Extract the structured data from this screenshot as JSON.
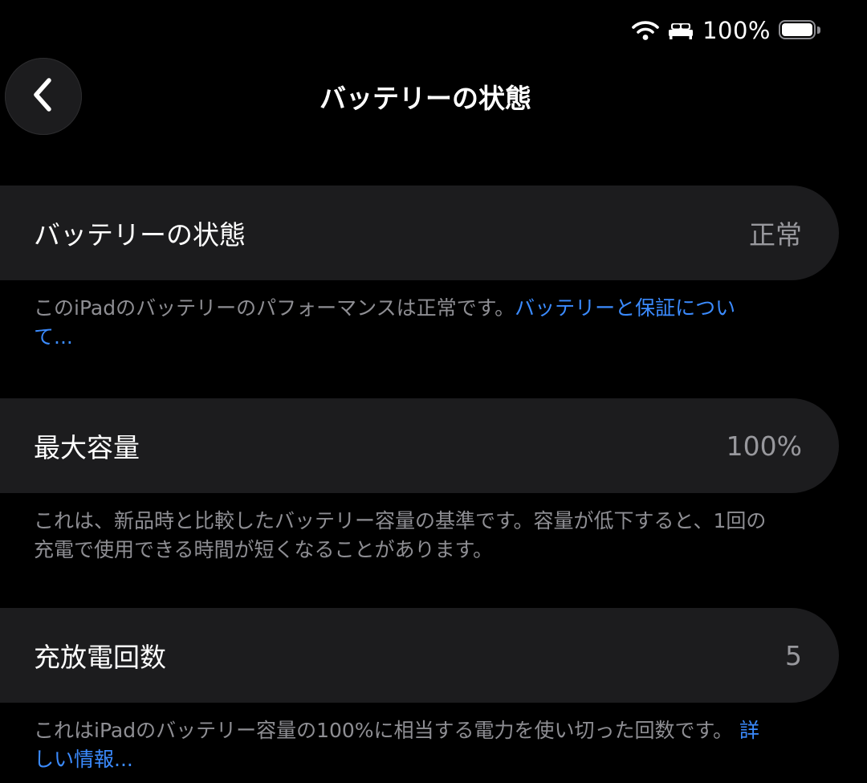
{
  "status_bar": {
    "wifi_icon": "wifi-icon",
    "sleep_icon": "bed-icon",
    "battery_percent": "100%",
    "battery_level": 1.0
  },
  "nav": {
    "back_icon": "chevron-left-icon",
    "title": "バッテリーの状態"
  },
  "rows": [
    {
      "label": "バッテリーの状態",
      "value": "正常",
      "footnote": "このiPadのバッテリーのパフォーマンスは正常です。",
      "footnote_link": "バッテリーと保証について..."
    },
    {
      "label": "最大容量",
      "value": "100%",
      "footnote": "これは、新品時と比較したバッテリー容量の基準です。容量が低下すると、1回の充電で使用できる時間が短くなることがあります。",
      "footnote_link": ""
    },
    {
      "label": "充放電回数",
      "value": "5",
      "footnote": "これはiPadのバッテリー容量の100%に相当する電力を使い切った回数です。",
      "footnote_link": "詳しい情報..."
    }
  ],
  "colors": {
    "background": "#000000",
    "row_background": "#1c1c1e",
    "secondary_text": "#8e8e93",
    "link": "#3b8bff"
  }
}
